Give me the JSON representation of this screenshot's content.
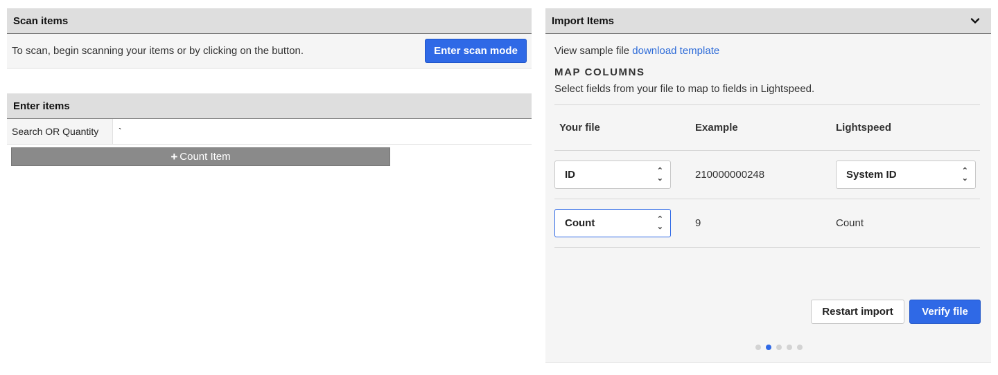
{
  "scan": {
    "title": "Scan items",
    "instructions": "To scan, begin scanning your items or by clicking on the button.",
    "button_label": "Enter scan mode"
  },
  "enter": {
    "title": "Enter items",
    "field_label": "Search OR Quantity",
    "field_value": "`",
    "count_button_label": "Count Item"
  },
  "import": {
    "title": "Import Items",
    "sample_prefix": "View sample file",
    "sample_link": "download template",
    "map_title": "MAP COLUMNS",
    "map_subtitle": "Select fields from your file to map to fields in Lightspeed.",
    "columns": [
      "Your file",
      "Example",
      "Lightspeed"
    ],
    "rows": [
      {
        "your_file": "ID",
        "example": "210000000248",
        "lightspeed": "System ID"
      },
      {
        "your_file": "Count",
        "example": "9",
        "lightspeed": "Count"
      }
    ],
    "restart_label": "Restart import",
    "verify_label": "Verify file",
    "step_current": 2,
    "step_total": 5
  },
  "colors": {
    "primary": "#2f69e6",
    "header_bg": "#dedede",
    "link": "#2d6bd8",
    "count_button": "#8a8a8a"
  }
}
